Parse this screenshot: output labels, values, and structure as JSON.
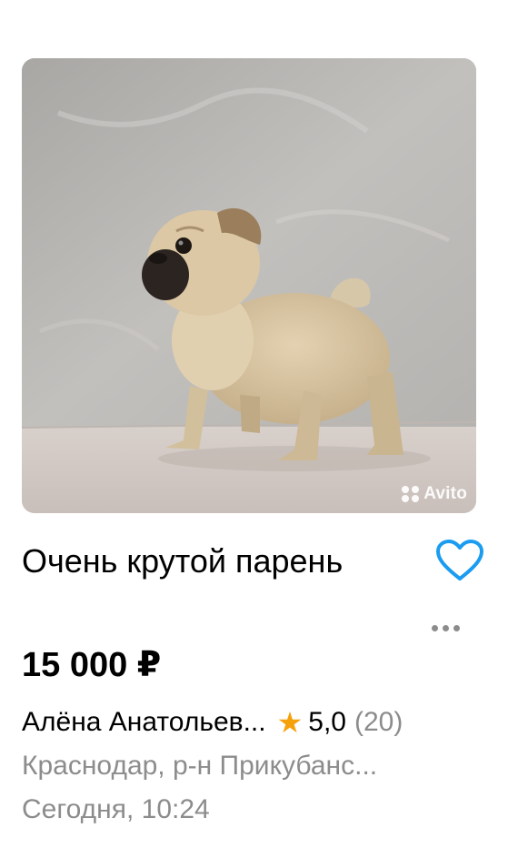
{
  "listing": {
    "title": "Очень крутой парень",
    "price": "15 000 ₽",
    "seller_name": "Алёна Анатольев...",
    "rating_star": "★",
    "rating": "5,0",
    "reviews": "(20)",
    "location": "Краснодар, р-н Прикубанс...",
    "date": "Сегодня, 10:24",
    "photo_watermark": "Avito"
  },
  "colors": {
    "favorite_accent": "#1a9cf0",
    "star": "#f5a10c",
    "secondary_text": "#8c8c8c"
  },
  "icons": {
    "favorite": "heart-outline-icon",
    "more": "more-dots-icon",
    "rating": "star-icon"
  }
}
